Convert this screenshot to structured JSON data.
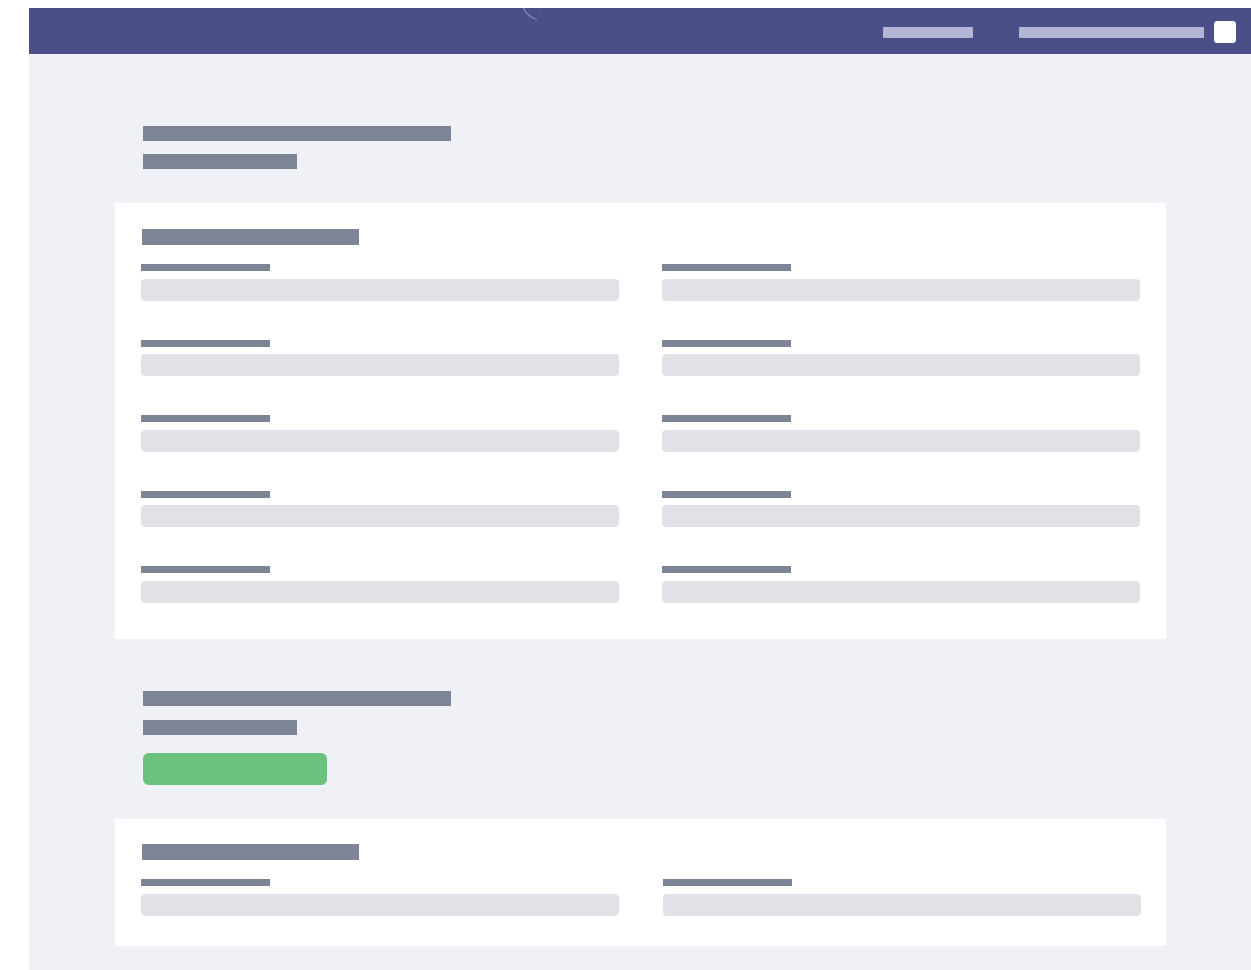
{
  "topbar": {
    "background": "#4b4f88",
    "nav_links": [
      {
        "label": ""
      },
      {
        "label": ""
      }
    ],
    "user_menu_icon": "square-icon"
  },
  "sections": [
    {
      "title": "",
      "subtitle": "",
      "panel": {
        "heading": "",
        "fields": [
          {
            "label": "",
            "value": ""
          },
          {
            "label": "",
            "value": ""
          },
          {
            "label": "",
            "value": ""
          },
          {
            "label": "",
            "value": ""
          },
          {
            "label": "",
            "value": ""
          },
          {
            "label": "",
            "value": ""
          },
          {
            "label": "",
            "value": ""
          },
          {
            "label": "",
            "value": ""
          },
          {
            "label": "",
            "value": ""
          },
          {
            "label": "",
            "value": ""
          }
        ]
      }
    },
    {
      "title": "",
      "subtitle": "",
      "action_button": {
        "label": "",
        "color": "#6ac27c"
      },
      "panel": {
        "heading": "",
        "fields": [
          {
            "label": "",
            "value": ""
          },
          {
            "label": "",
            "value": ""
          }
        ]
      }
    }
  ],
  "colors": {
    "page_background": "#f0f1f6",
    "placeholder_text": "#7c8495",
    "input_placeholder": "#e1e2e7",
    "panel": "#ffffff"
  }
}
